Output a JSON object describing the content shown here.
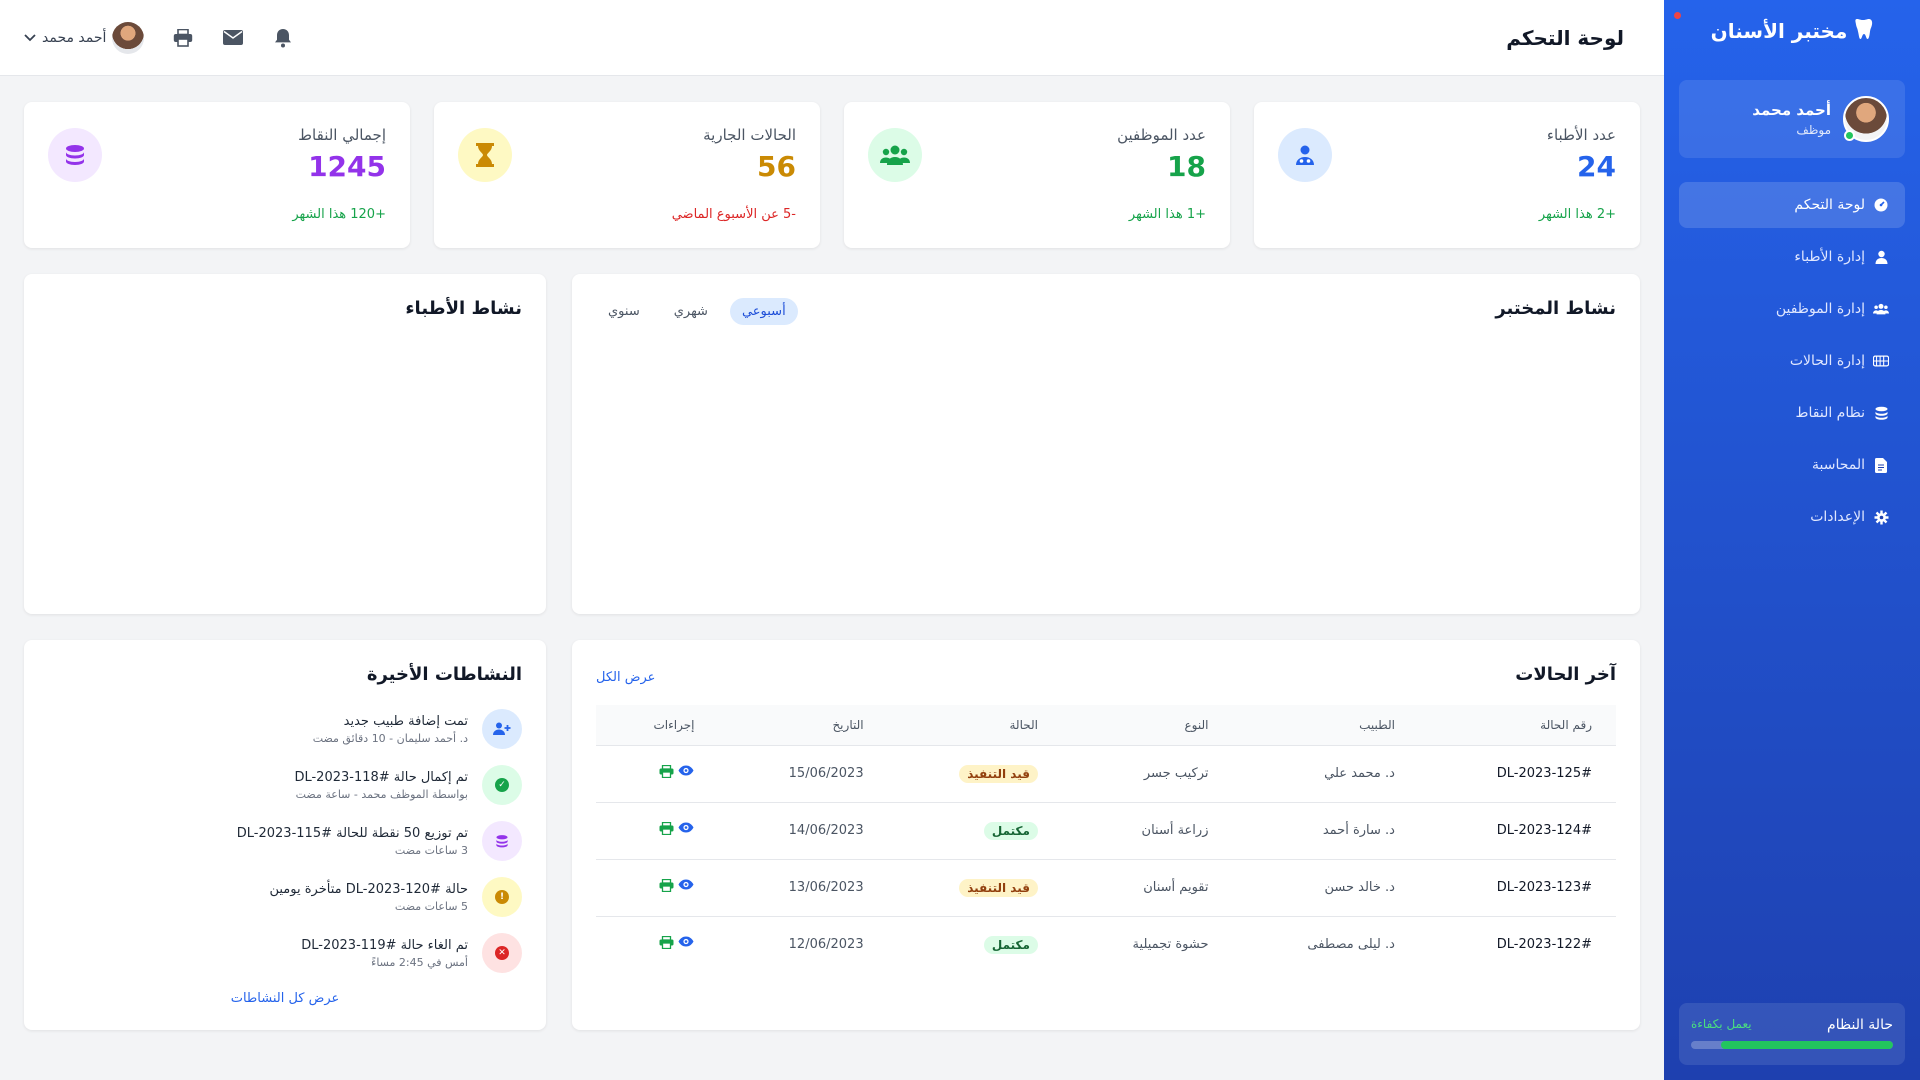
{
  "sidebar": {
    "brand": "مختبر الأسنان",
    "user": {
      "name": "أحمد محمد",
      "role": "موظف"
    },
    "items": [
      {
        "label": "لوحة التحكم",
        "icon": "dashboard-icon",
        "active": true
      },
      {
        "label": "إدارة الأطباء",
        "icon": "doctor-icon"
      },
      {
        "label": "إدارة الموظفين",
        "icon": "users-icon"
      },
      {
        "label": "إدارة الحالات",
        "icon": "teeth-icon"
      },
      {
        "label": "نظام النقاط",
        "icon": "coins-icon"
      },
      {
        "label": "المحاسبة",
        "icon": "invoice-icon"
      },
      {
        "label": "الإعدادات",
        "icon": "gear-icon"
      }
    ],
    "system": {
      "label": "حالة النظام",
      "status": "يعمل بكفاءة",
      "level_percent": 85
    }
  },
  "header": {
    "title": "لوحة التحكم",
    "user_name": "أحمد محمد"
  },
  "stats": [
    {
      "label": "عدد الأطباء",
      "value": "24",
      "delta": "+2 هذا الشهر",
      "color": "#2563eb",
      "bg": "#dbeafe",
      "delta_color": "#16a34a",
      "icon": "doctor-icon"
    },
    {
      "label": "عدد الموظفين",
      "value": "18",
      "delta": "+1 هذا الشهر",
      "color": "#16a34a",
      "bg": "#dcfce7",
      "delta_color": "#16a34a",
      "icon": "users-icon"
    },
    {
      "label": "الحالات الجارية",
      "value": "56",
      "delta": "-5 عن الأسبوع الماضي",
      "color": "#ca8a04",
      "bg": "#fef9c3",
      "delta_color": "#dc2626",
      "icon": "hourglass-icon"
    },
    {
      "label": "إجمالي النقاط",
      "value": "1245",
      "delta": "+120 هذا الشهر",
      "color": "#9333ea",
      "bg": "#f3e8ff",
      "delta_color": "#16a34a",
      "icon": "coins-icon"
    }
  ],
  "lab_activity": {
    "title": "نشاط المختبر",
    "tabs": [
      {
        "label": "أسبوعي",
        "active": true
      },
      {
        "label": "شهري"
      },
      {
        "label": "سنوي"
      }
    ]
  },
  "doctor_activity": {
    "title": "نشاط الأطباء"
  },
  "cases": {
    "title": "آخر الحالات",
    "view_all": "عرض الكل",
    "columns": [
      "رقم الحالة",
      "الطبيب",
      "النوع",
      "الحالة",
      "التاريخ",
      "إجراءات"
    ],
    "rows": [
      {
        "id": "#DL-2023-125",
        "doctor": "د. محمد علي",
        "type": "تركيب جسر",
        "status": "قيد التنفيذ",
        "status_kind": "progress",
        "date": "15/06/2023"
      },
      {
        "id": "#DL-2023-124",
        "doctor": "د. سارة أحمد",
        "type": "زراعة أسنان",
        "status": "مكتمل",
        "status_kind": "done",
        "date": "14/06/2023"
      },
      {
        "id": "#DL-2023-123",
        "doctor": "د. خالد حسن",
        "type": "تقويم أسنان",
        "status": "قيد التنفيذ",
        "status_kind": "progress",
        "date": "13/06/2023"
      },
      {
        "id": "#DL-2023-122",
        "doctor": "د. ليلى مصطفى",
        "type": "حشوة تجميلية",
        "status": "مكتمل",
        "status_kind": "done",
        "date": "12/06/2023"
      }
    ]
  },
  "activities": {
    "title": "النشاطات الأخيرة",
    "view_all": "عرض كل النشاطات",
    "items": [
      {
        "title": "تمت إضافة طبيب جديد",
        "sub": "د. أحمد سليمان - 10 دقائق مضت",
        "icon": "add-user-icon",
        "bg": "#dbeafe",
        "color": "#2563eb"
      },
      {
        "title": "تم إكمال حالة #DL-2023-118",
        "sub": "بواسطة الموظف محمد - ساعة مضت",
        "icon": "check-icon",
        "bg": "#dcfce7",
        "color": "#16a34a"
      },
      {
        "title": "تم توزيع 50 نقطة للحالة #DL-2023-115",
        "sub": "3 ساعات مضت",
        "icon": "coins-icon",
        "bg": "#f3e8ff",
        "color": "#9333ea"
      },
      {
        "title": "حالة #DL-2023-120 متأخرة يومين",
        "sub": "5 ساعات مضت",
        "icon": "warning-icon",
        "bg": "#fef9c3",
        "color": "#ca8a04"
      },
      {
        "title": "تم الغاء حالة #DL-2023-119",
        "sub": "أمس في 2:45 مساءً",
        "icon": "cancel-icon",
        "bg": "#fee2e2",
        "color": "#dc2626"
      }
    ]
  }
}
